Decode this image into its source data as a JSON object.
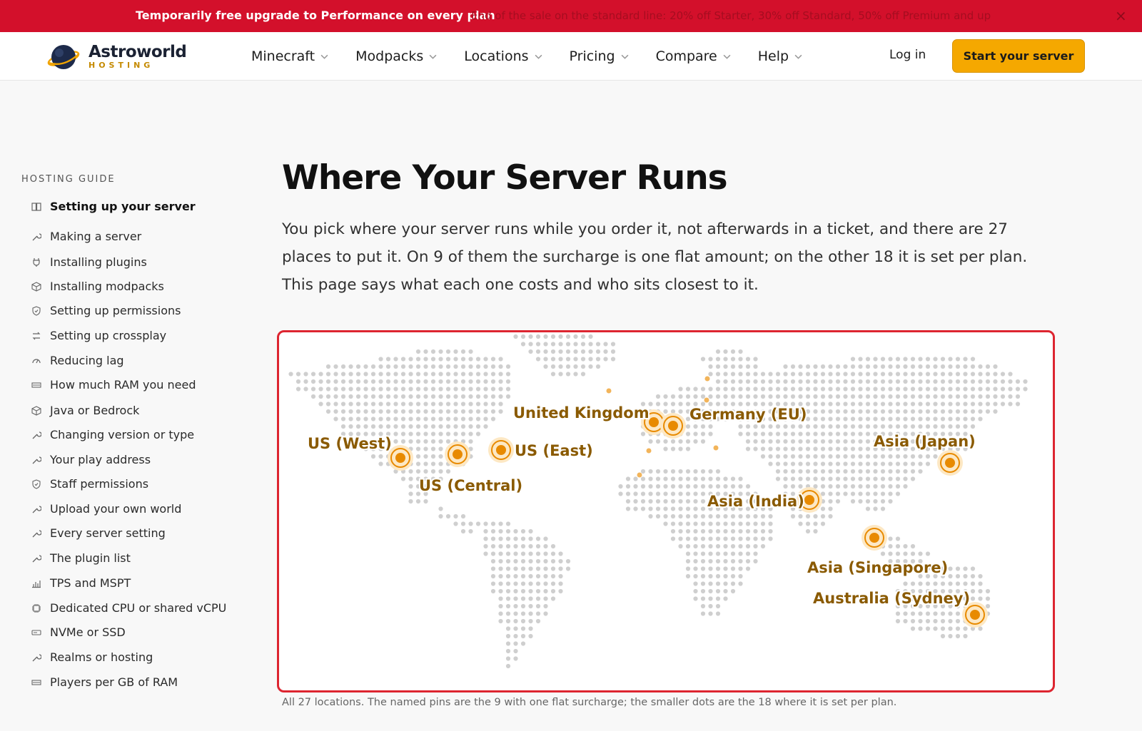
{
  "banner": {
    "main": "Temporarily free upgrade to Performance on every plan",
    "sub": "End of the sale on the standard line: 20% off Starter, 30% off Standard, 50% off Premium and up",
    "close_icon": "close-icon"
  },
  "header": {
    "logo_name": "Astroworld",
    "logo_sub": "HOSTING",
    "nav": [
      {
        "label": "Minecraft"
      },
      {
        "label": "Modpacks"
      },
      {
        "label": "Locations"
      },
      {
        "label": "Pricing"
      },
      {
        "label": "Compare"
      },
      {
        "label": "Help"
      }
    ],
    "login": "Log in",
    "cta": "Start your server"
  },
  "sidebar": {
    "title": "HOSTING GUIDE",
    "items": [
      {
        "label": "Setting up your server",
        "icon": "book-icon",
        "active": true
      },
      {
        "label": "Making a server",
        "icon": "wrench-icon"
      },
      {
        "label": "Installing plugins",
        "icon": "plug-icon"
      },
      {
        "label": "Installing modpacks",
        "icon": "box-icon"
      },
      {
        "label": "Setting up permissions",
        "icon": "shield-icon"
      },
      {
        "label": "Setting up crossplay",
        "icon": "swap-icon"
      },
      {
        "label": "Reducing lag",
        "icon": "gauge-icon"
      },
      {
        "label": "How much RAM you need",
        "icon": "memory-icon"
      },
      {
        "label": "Java or Bedrock",
        "icon": "box-icon"
      },
      {
        "label": "Changing version or type",
        "icon": "wrench-icon"
      },
      {
        "label": "Your play address",
        "icon": "wrench-icon"
      },
      {
        "label": "Staff permissions",
        "icon": "shield-icon"
      },
      {
        "label": "Upload your own world",
        "icon": "wrench-icon"
      },
      {
        "label": "Every server setting",
        "icon": "wrench-icon"
      },
      {
        "label": "The plugin list",
        "icon": "wrench-icon"
      },
      {
        "label": "TPS and MSPT",
        "icon": "bars-icon"
      },
      {
        "label": "Dedicated CPU or shared vCPU",
        "icon": "cpu-icon"
      },
      {
        "label": "NVMe or SSD",
        "icon": "drive-icon"
      },
      {
        "label": "Realms or hosting",
        "icon": "wrench-icon"
      },
      {
        "label": "Players per GB of RAM",
        "icon": "memory-icon"
      }
    ]
  },
  "main": {
    "title": "Where Your Server Runs",
    "intro": "You pick where your server runs while you order it, not afterwards in a ticket, and there are 27 places to put it. On 9 of them the surcharge is one flat amount; on the other 18 it is set per plan. This page says what each one costs and who sits closest to it.",
    "caption": "All 27 locations. The named pins are the 9 with one flat surcharge; the smaller dots are the 18 where it is set per plan."
  },
  "map": {
    "pin_color": "#e88a00",
    "label_color": "#8a5a00",
    "locations": [
      {
        "label": "US (West)"
      },
      {
        "label": "US (Central)"
      },
      {
        "label": "US (East)"
      },
      {
        "label": "United Kingdom"
      },
      {
        "label": "Germany (EU)"
      },
      {
        "label": "Asia (India)"
      },
      {
        "label": "Asia (Singapore)"
      },
      {
        "label": "Asia (Japan)"
      },
      {
        "label": "Australia (Sydney)"
      }
    ]
  }
}
